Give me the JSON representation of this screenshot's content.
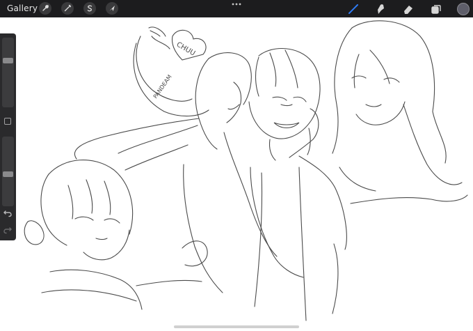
{
  "toolbar": {
    "gallery_label": "Gallery",
    "left_tools": [
      {
        "name": "actions",
        "icon": "wrench-icon"
      },
      {
        "name": "adjustments",
        "icon": "magic-wand-icon"
      },
      {
        "name": "selection",
        "icon": "selection-s-icon"
      },
      {
        "name": "transform",
        "icon": "arrow-cursor-icon"
      }
    ],
    "more_icon": "more-dots-icon",
    "right_tools": [
      {
        "name": "brush",
        "icon": "brush-icon",
        "active": true
      },
      {
        "name": "smudge",
        "icon": "smudge-icon",
        "active": false
      },
      {
        "name": "eraser",
        "icon": "eraser-icon",
        "active": false
      },
      {
        "name": "layers",
        "icon": "layers-icon",
        "active": false
      }
    ],
    "active_color": "#5e5e6a",
    "accent_color": "#2f7cf6"
  },
  "sidebar": {
    "brush_size_level": 0.68,
    "opacity_level": 0.45
  },
  "canvas": {
    "sketch_text": {
      "heart_label": "CHUU",
      "hair_label": "PANDEAM"
    }
  }
}
